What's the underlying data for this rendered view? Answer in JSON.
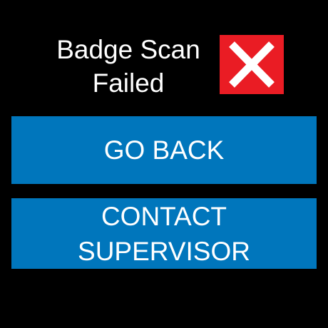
{
  "header": {
    "title_line1": "Badge Scan",
    "title_line2": "Failed",
    "status_icon": "x-mark-icon",
    "status_color": "#ea1c24"
  },
  "actions": {
    "go_back_label": "GO BACK",
    "contact_line1": "CONTACT",
    "contact_line2": "SUPERVISOR",
    "button_color": "#0076bc"
  }
}
